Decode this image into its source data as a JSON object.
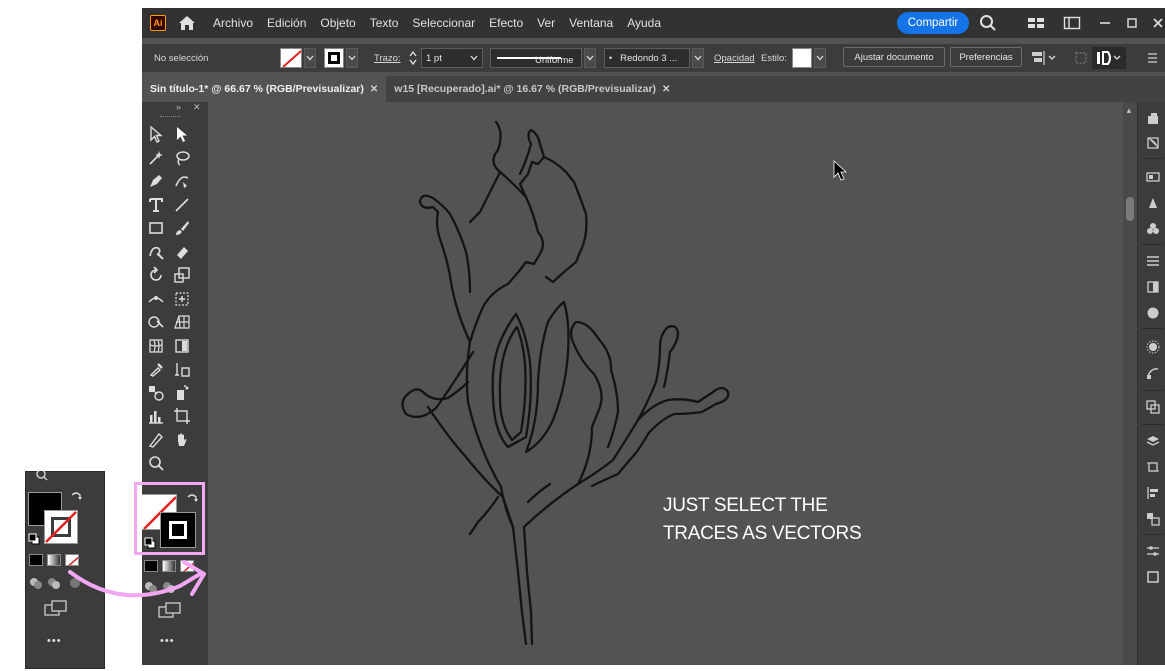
{
  "app": {
    "logo_text": "Ai",
    "menu": [
      "Archivo",
      "Edición",
      "Objeto",
      "Texto",
      "Seleccionar",
      "Efecto",
      "Ver",
      "Ventana",
      "Ayuda"
    ],
    "share_label": "Compartir"
  },
  "control_bar": {
    "selection_status": "No selección",
    "stroke_label": "Trazo:",
    "stroke_weight": "1 pt",
    "profile_label": "Uniforme",
    "brush_label": "Redondo 3 ...",
    "opacity_label": "Opacidad",
    "style_label": "Estilo:",
    "fit_document_button": "Ajustar documento",
    "preferences_button": "Preferencias"
  },
  "tabs": [
    {
      "label": "Sin título-1* @ 66.67 % (RGB/Previsualizar)",
      "active": true
    },
    {
      "label": "w15 [Recuperado].ai* @ 16.67 % (RGB/Previsualizar)",
      "active": false
    }
  ],
  "tools": [
    "selection-tool-icon",
    "direct-selection-tool-icon",
    "magic-wand-tool-icon",
    "lasso-tool-icon",
    "pen-tool-icon",
    "curvature-tool-icon",
    "type-tool-icon",
    "line-segment-tool-icon",
    "rectangle-tool-icon",
    "paintbrush-tool-icon",
    "shaper-tool-icon",
    "eraser-tool-icon",
    "rotate-tool-icon",
    "scale-tool-icon",
    "width-tool-icon",
    "free-transform-tool-icon",
    "shape-builder-tool-icon",
    "perspective-grid-tool-icon",
    "mesh-tool-icon",
    "gradient-tool-icon",
    "eyedropper-tool-icon",
    "measure-tool-icon",
    "blend-tool-icon",
    "symbol-sprayer-tool-icon",
    "column-graph-tool-icon",
    "artboard-tool-icon",
    "slice-tool-icon",
    "hand-tool-icon",
    "zoom-tool-icon"
  ],
  "annotation": {
    "instruction": "JUST SELECT THE TRACES AS VECTORS"
  },
  "more_tools_label": "•••",
  "colors": {
    "highlight": "#f2a7f2",
    "share_button": "#1473e6",
    "logo": "#ff9a00"
  }
}
